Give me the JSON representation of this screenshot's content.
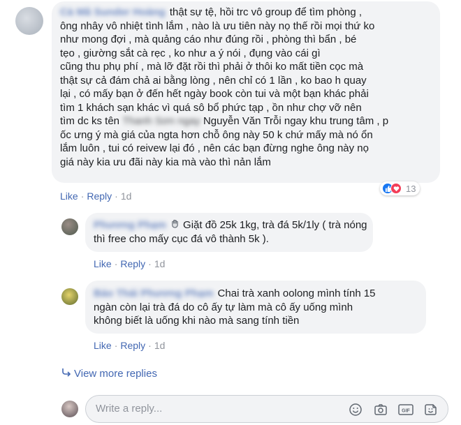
{
  "main_comment": {
    "author_blurred": "Cà Mã Sunder Hoàng",
    "lines": [
      "thật sự tệ, hồi trc vô group để tìm phòng ,",
      "ông nhây vô nhiệt tình lắm , nào là ưu tiên này nọ thế rồi mọi thứ ko",
      "như mong đợi , mà quảng cáo như đúng rồi , phòng thì bẩn , bé",
      "tẹo , giường sắt cà rẹc , ko như a ý nói , đụng vào cái gì",
      "cũng thu phụ phí , mà lỡ đặt rồi thì phải ở thôi ko mất tiền cọc mà",
      "thật sự cả đám chả ai bằng lòng , nên chỉ có 1 lần , ko bao h quay",
      "lại , có mấy bạn ở đến hết ngày book còn tui và một bạn khác phải",
      "tìm 1 khách sạn khác vì quá sô bổ phức tạp , ồn như chợ vỡ nên"
    ],
    "line9_prefix": "tìm dc ks tên",
    "line9_blurred": "Thanh Sơn ngay",
    "line9_suffix": "Nguyễn Văn Trỗi ngay khu trung tâm ,  p",
    "lines_after": [
      "ốc ưng ý mà giá của ngta hơn chỗ ông này 50 k chứ mấy mà nó ổn",
      "lắm luôn , tui có reivew lại đó , nên các bạn đừng nghe ông này nọ",
      "giá này kia ưu đãi này kia mà vào thì nản lắm"
    ],
    "like": "Like",
    "reply": "Reply",
    "time": "1d",
    "reaction_count": "13"
  },
  "reply1": {
    "author_blurred": "Phương Phạm",
    "line1": "Giặt đồ 25k 1kg, trà đá 5k/1ly ( trà nóng",
    "line2": "thì free cho mấy cục đá vô thành 5k ).",
    "like": "Like",
    "reply": "Reply",
    "time": "1d"
  },
  "reply2": {
    "author_blurred": "Bảo Thái Phương Phạm",
    "line1": "Chai trà xanh oolong mình tính 15",
    "line2": "ngàn còn lại trà đá do cô ấy tự làm mà cô ấy uống mình",
    "line3": "không biết là uống khi nào mà sang tính tiền",
    "like": "Like",
    "reply": "Reply",
    "time": "1d"
  },
  "view_more": "View more replies",
  "reply_input": {
    "placeholder": "Write a reply..."
  },
  "colors": {
    "link": "#4267b2",
    "bubble": "#f2f3f5",
    "like": "#1877f2",
    "love": "#f33e58"
  },
  "icons": [
    "emoji-icon",
    "camera-icon",
    "gif-icon",
    "sticker-icon",
    "wave-hand-icon",
    "reply-arrow-icon"
  ]
}
